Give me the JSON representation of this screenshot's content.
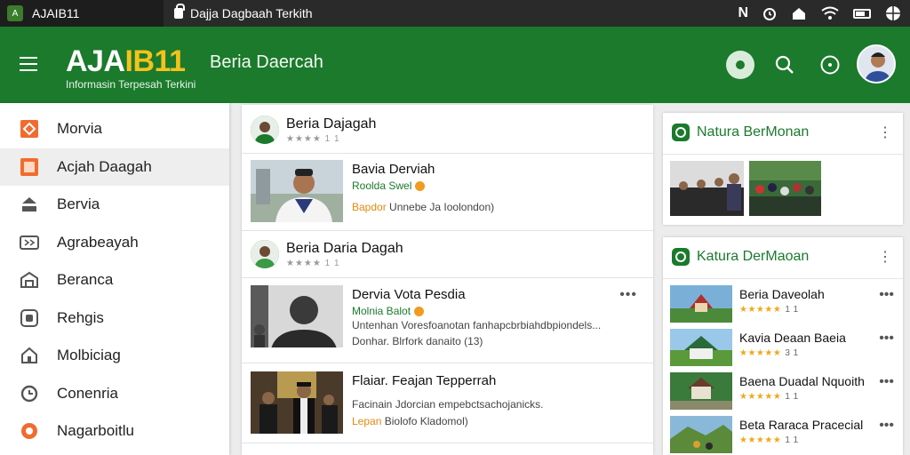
{
  "statusbar": {
    "app_title": "AJAIB11",
    "tab_title": "Dajja Dagbaah Terkith"
  },
  "header": {
    "brand_part1": "AJA",
    "brand_part2": "IB11",
    "tagline": "Informasin Terpesah Terkini",
    "section_title": "Beria Daercah"
  },
  "sidebar": {
    "items": [
      {
        "label": "Morvia",
        "icon": "news-icon"
      },
      {
        "label": "Acjah Daagah",
        "icon": "region-icon"
      },
      {
        "label": "Bervia",
        "icon": "inbox-icon"
      },
      {
        "label": "Agrabeayah",
        "icon": "video-icon"
      },
      {
        "label": "Beranca",
        "icon": "building-icon"
      },
      {
        "label": "Rehgis",
        "icon": "category-icon"
      },
      {
        "label": "Molbiciag",
        "icon": "home-icon"
      },
      {
        "label": "Conenria",
        "icon": "time-icon"
      },
      {
        "label": "Nagarboitlu",
        "icon": "trending-icon"
      }
    ]
  },
  "feed": {
    "sources": [
      {
        "name": "Beria Dajagah",
        "meta": "★★★★ 1 1"
      },
      {
        "name": "Beria Daria Dagah",
        "meta": "★★★★ 1 1"
      }
    ],
    "stories": [
      {
        "title": "Bavia Derviah",
        "tag": "Roolda Swel",
        "line1_hl": "Bapdor",
        "line1": "Unnebe Ja Ioolondon)",
        "line2": ""
      },
      {
        "title": "Dervia Vota Pesdia",
        "tag": "Molnia Balot",
        "line1_hl": "",
        "line1": "Untenhan Voresfoanotan fanhapcbrbiahdbpiondels...",
        "line2": "Donhar. Blrfork danaito (13)"
      },
      {
        "title": "Flaiar. Feajan Tepperrah",
        "tag": "",
        "line1_hl": "",
        "line1": "Facinain Jdorcian empebctsachojanicks.",
        "line2_hl": "Lepan",
        "line2": "Biolofo Kladomol)"
      }
    ]
  },
  "panel1": {
    "title": "Natura BerMonan"
  },
  "panel2": {
    "title": "Katura DerMaoan",
    "items": [
      {
        "title": "Beria Daveolah",
        "stars": "★★★★★",
        "count": "1 1"
      },
      {
        "title": "Kavia Deaan Baeia",
        "stars": "★★★★★",
        "count": "3 1"
      },
      {
        "title": "Baena Duadal Nquoith",
        "stars": "★★★★★",
        "count": "1 1"
      },
      {
        "title": "Beta Raraca Pracecial",
        "stars": "★★★★★",
        "count": "1 1"
      }
    ]
  },
  "colors": {
    "brand_green": "#1b7a2c",
    "brand_yellow": "#f5c21b",
    "accent_orange": "#f29b1e"
  }
}
